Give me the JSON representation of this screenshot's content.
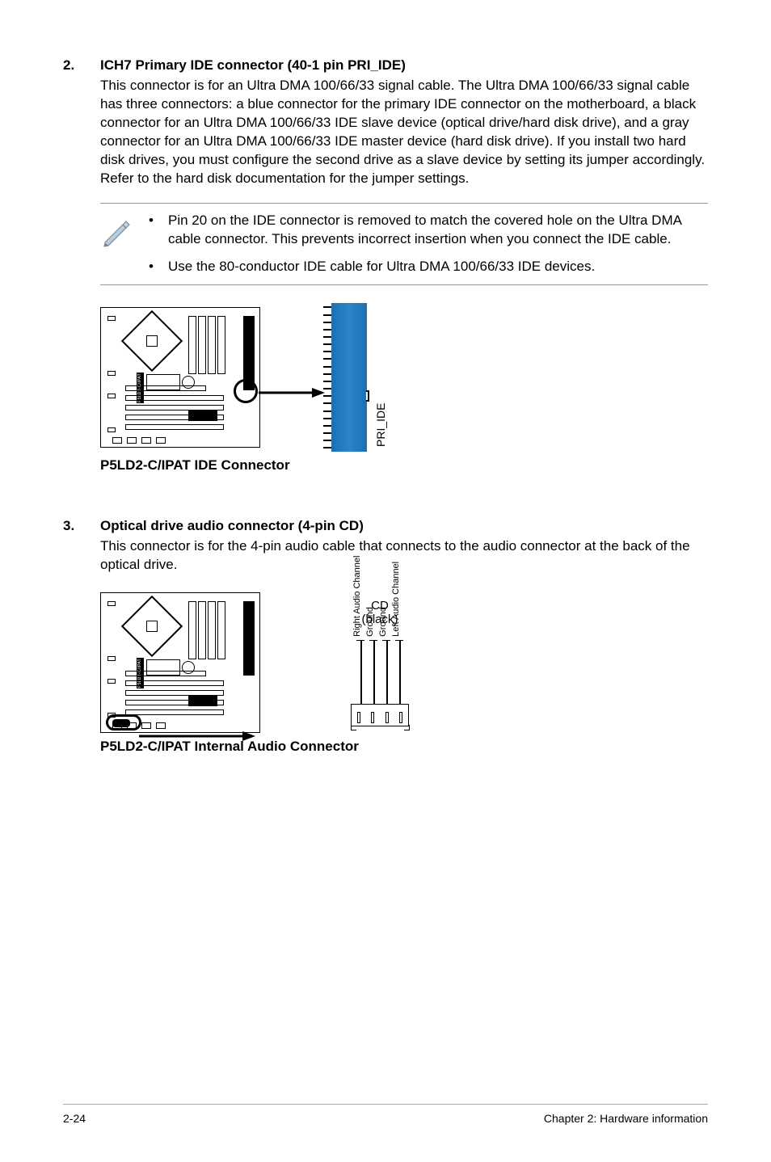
{
  "section2": {
    "num": "2.",
    "heading": "ICH7 Primary IDE connector (40-1 pin PRI_IDE)",
    "body": "This connector is for an Ultra DMA 100/66/33 signal cable. The Ultra DMA 100/66/33 signal cable has three connectors: a blue connector for the primary IDE connector on the motherboard, a black connector for an Ultra DMA 100/66/33 IDE slave device (optical drive/hard disk drive), and a gray connector for an Ultra DMA 100/66/33 IDE master device (hard disk drive). If you install two hard disk drives, you must configure the second drive as a slave device by setting its jumper accordingly. Refer to the hard disk documentation for the jumper settings.",
    "notes": [
      "Pin 20 on the IDE connector is removed to match the covered hole on the Ultra DMA cable connector. This prevents incorrect insertion when you connect the IDE cable.",
      "Use the 80-conductor IDE cable for Ultra DMA 100/66/33 IDE devices."
    ],
    "figure": {
      "pcb_label": "P5LD2-C/IPAT",
      "connector_label": "PRI_IDE",
      "caption": "P5LD2-C/IPAT IDE Connector"
    }
  },
  "section3": {
    "num": "3.",
    "heading": "Optical drive audio connector (4-pin CD)",
    "body": "This connector is for the 4-pin audio cable that connects to the audio connector at the back of the optical drive.",
    "figure": {
      "pcb_label": "P5LD2-C/IPAT",
      "header_title": "CD",
      "header_sub": "(black)",
      "pins": [
        "Right Audio Channel",
        "Ground",
        "Ground",
        "Left Audio Channel"
      ],
      "caption": "P5LD2-C/IPAT Internal Audio Connector"
    }
  },
  "footer": {
    "left": "2-24",
    "right": "Chapter 2: Hardware information"
  },
  "bullet_char": "•"
}
